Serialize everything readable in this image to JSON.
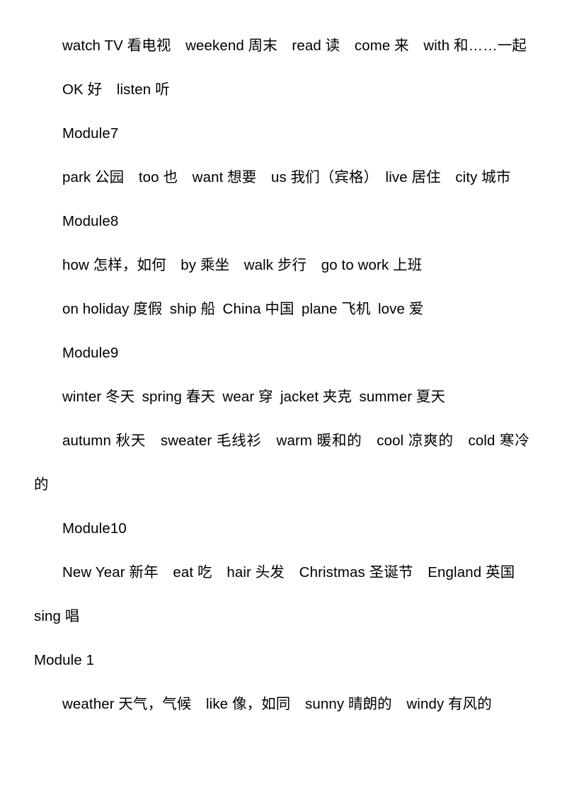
{
  "document": {
    "type": "vocabulary-word-list",
    "language": "zh-CN + en",
    "background_color": "#ffffff",
    "text_color": "#000000",
    "paragraphs": [
      {
        "id": "p1",
        "indent": true,
        "text": "watch TV 看电视 weekend 周末 read 读 come 来 with 和……一起"
      },
      {
        "id": "p2",
        "indent": true,
        "text": "OK 好 listen 听"
      },
      {
        "id": "p3",
        "indent": true,
        "text": "Module7"
      },
      {
        "id": "p4",
        "indent": true,
        "text": "park 公园 too 也 want 想要 us 我们（宾格） live 居住 city 城市"
      },
      {
        "id": "p5",
        "indent": true,
        "text": "Module8"
      },
      {
        "id": "p6",
        "indent": true,
        "text": "how 怎样，如何 by 乘坐 walk 步行 go to work 上班"
      },
      {
        "id": "p7",
        "indent": true,
        "text": "on holiday 度假 ship 船 China 中国 plane 飞机 love 爱"
      },
      {
        "id": "p8",
        "indent": true,
        "text": "Module9"
      },
      {
        "id": "p9",
        "indent": true,
        "text": "winter 冬天 spring 春天 wear 穿 jacket 夹克 summer 夏天"
      },
      {
        "id": "p10",
        "indent": true,
        "text": "autumn 秋天 sweater 毛线衫 warm 暖和的 cool 凉爽的 cold 寒冷的"
      },
      {
        "id": "p11",
        "indent": true,
        "text": "Module10"
      },
      {
        "id": "p12",
        "indent": true,
        "text": "New Year 新年 eat 吃 hair 头发 Christmas 圣诞节 England 英国 sing 唱"
      },
      {
        "id": "p13",
        "indent": false,
        "text": "Module 1"
      },
      {
        "id": "p14",
        "indent": true,
        "text": "weather 天气，气候 like 像，如同 sunny 晴朗的 windy 有风的"
      }
    ],
    "module_headings": [
      "Module7",
      "Module8",
      "Module9",
      "Module10",
      "Module 1"
    ],
    "vocabulary_entries": [
      {
        "en": "watch TV",
        "zh": "看电视"
      },
      {
        "en": "weekend",
        "zh": "周末"
      },
      {
        "en": "read",
        "zh": "读"
      },
      {
        "en": "come",
        "zh": "来"
      },
      {
        "en": "with",
        "zh": "和……一起"
      },
      {
        "en": "OK",
        "zh": "好"
      },
      {
        "en": "listen",
        "zh": "听"
      },
      {
        "en": "park",
        "zh": "公园"
      },
      {
        "en": "too",
        "zh": "也"
      },
      {
        "en": "want",
        "zh": "想要"
      },
      {
        "en": "us",
        "zh": "我们（宾格）"
      },
      {
        "en": "live",
        "zh": "居住"
      },
      {
        "en": "city",
        "zh": "城市"
      },
      {
        "en": "how",
        "zh": "怎样，如何"
      },
      {
        "en": "by",
        "zh": "乘坐"
      },
      {
        "en": "walk",
        "zh": "步行"
      },
      {
        "en": "go to work",
        "zh": "上班"
      },
      {
        "en": "on holiday",
        "zh": "度假"
      },
      {
        "en": "ship",
        "zh": "船"
      },
      {
        "en": "China",
        "zh": "中国"
      },
      {
        "en": "plane",
        "zh": "飞机"
      },
      {
        "en": "love",
        "zh": "爱"
      },
      {
        "en": "winter",
        "zh": "冬天"
      },
      {
        "en": "spring",
        "zh": "春天"
      },
      {
        "en": "wear",
        "zh": "穿"
      },
      {
        "en": "jacket",
        "zh": "夹克"
      },
      {
        "en": "summer",
        "zh": "夏天"
      },
      {
        "en": "autumn",
        "zh": "秋天"
      },
      {
        "en": "sweater",
        "zh": "毛线衫"
      },
      {
        "en": "warm",
        "zh": "暖和的"
      },
      {
        "en": "cool",
        "zh": "凉爽的"
      },
      {
        "en": "cold",
        "zh": "寒冷的"
      },
      {
        "en": "New Year",
        "zh": "新年"
      },
      {
        "en": "eat",
        "zh": "吃"
      },
      {
        "en": "hair",
        "zh": "头发"
      },
      {
        "en": "Christmas",
        "zh": "圣诞节"
      },
      {
        "en": "England",
        "zh": "英国"
      },
      {
        "en": "sing",
        "zh": "唱"
      },
      {
        "en": "weather",
        "zh": "天气，气候"
      },
      {
        "en": "like",
        "zh": "像，如同"
      },
      {
        "en": "sunny",
        "zh": "晴朗的"
      },
      {
        "en": "windy",
        "zh": "有风的"
      }
    ]
  }
}
